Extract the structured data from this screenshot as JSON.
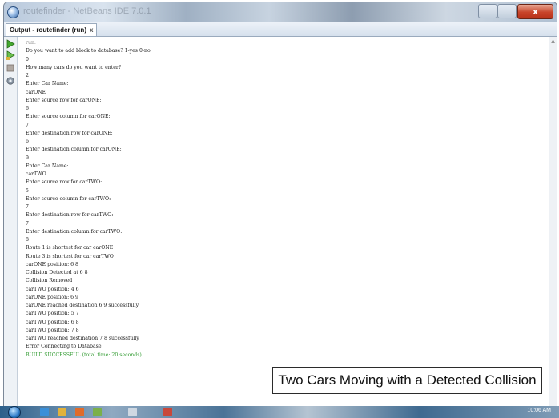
{
  "window": {
    "title": "routefinder - NetBeans IDE 7.0.1",
    "close_label": "x"
  },
  "output_tab": {
    "label": "Output - routefinder (run)",
    "close_label": "x"
  },
  "console": {
    "lines": [
      {
        "text": "run:",
        "style": "muted"
      },
      {
        "text": "Do you want to add block to database? 1-yes 0-no",
        "style": "normal"
      },
      {
        "text": "0",
        "style": "normal"
      },
      {
        "text": "How many cars do you want to enter?",
        "style": "normal"
      },
      {
        "text": "2",
        "style": "normal"
      },
      {
        "text": "Enter Car Name:",
        "style": "normal"
      },
      {
        "text": "carONE",
        "style": "normal"
      },
      {
        "text": "Enter source row for carONE:",
        "style": "normal"
      },
      {
        "text": "6",
        "style": "normal"
      },
      {
        "text": "Enter source column for carONE:",
        "style": "normal"
      },
      {
        "text": "7",
        "style": "normal"
      },
      {
        "text": "Enter destination row for carONE:",
        "style": "normal"
      },
      {
        "text": "6",
        "style": "normal"
      },
      {
        "text": "Enter destination column for carONE:",
        "style": "normal"
      },
      {
        "text": "9",
        "style": "normal"
      },
      {
        "text": "Enter Car Name:",
        "style": "normal"
      },
      {
        "text": "carTWO",
        "style": "normal"
      },
      {
        "text": "Enter source row for carTWO:",
        "style": "normal"
      },
      {
        "text": "5",
        "style": "normal"
      },
      {
        "text": "Enter source column for carTWO:",
        "style": "normal"
      },
      {
        "text": "7",
        "style": "normal"
      },
      {
        "text": "Enter destination row for carTWO:",
        "style": "normal"
      },
      {
        "text": "7",
        "style": "normal"
      },
      {
        "text": "Enter destination column for carTWO:",
        "style": "normal"
      },
      {
        "text": "8",
        "style": "normal"
      },
      {
        "text": "Route 1 is shortest for car carONE",
        "style": "normal"
      },
      {
        "text": "Route 3 is shortest for car carTWO",
        "style": "normal"
      },
      {
        "text": "carONE position: 6 8",
        "style": "normal"
      },
      {
        "text": "Collision Detected at 6 8",
        "style": "normal"
      },
      {
        "text": "Collision Removed",
        "style": "normal"
      },
      {
        "text": "carTWO position: 4 6",
        "style": "normal"
      },
      {
        "text": "carONE position: 6 9",
        "style": "normal"
      },
      {
        "text": "carONE reached destination 6 9 successfully",
        "style": "normal"
      },
      {
        "text": "carTWO position: 5 7",
        "style": "normal"
      },
      {
        "text": "carTWO position: 6 8",
        "style": "normal"
      },
      {
        "text": "carTWO position: 7 8",
        "style": "normal"
      },
      {
        "text": "carTWO reached destination 7 8 successfully",
        "style": "normal"
      },
      {
        "text": "Error Connecting to Database",
        "style": "normal"
      },
      {
        "text": "BUILD SUCCESSFUL (total time: 20 seconds)",
        "style": "success"
      }
    ]
  },
  "caption": {
    "text": "Two Cars Moving with a Detected Collision"
  },
  "taskbar": {
    "clock": "10:06 AM"
  },
  "colors": {
    "success_text": "#2f9a2f",
    "muted_text": "#8a8a8a",
    "close_button": "#c8442a"
  },
  "icons": {
    "toolbar": [
      "run-icon",
      "rerun-icon",
      "stop-icon",
      "settings-icon"
    ],
    "taskbar": [
      "start-orb-icon",
      "ie-icon",
      "explorer-icon",
      "media-icon",
      "app-icon",
      "netbeans-icon",
      "paint-icon"
    ]
  }
}
